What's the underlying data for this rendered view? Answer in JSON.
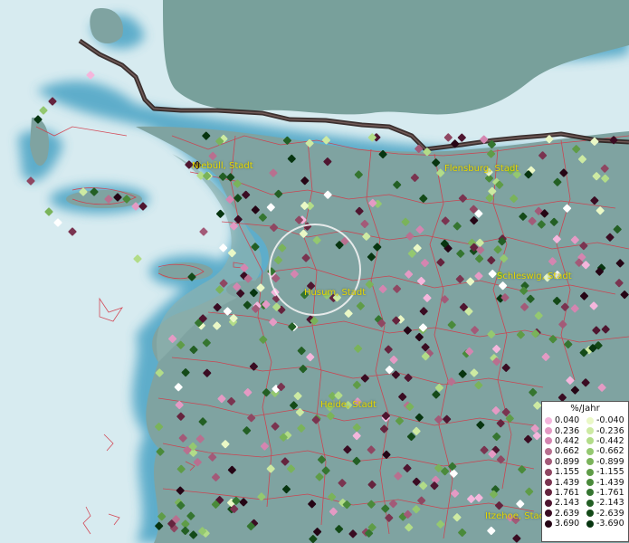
{
  "cities": [
    {
      "key": "niebuell",
      "label": "Niebüll, Stadt"
    },
    {
      "key": "flensburg",
      "label": "Flensburg, Stadt"
    },
    {
      "key": "schleswig",
      "label": "Schleswig, Stadt"
    },
    {
      "key": "husum",
      "label": "Husum, Stadt"
    },
    {
      "key": "heide",
      "label": "Heide, Stadt"
    },
    {
      "key": "itzehoe",
      "label": "Itzehoe, Stadt"
    }
  ],
  "legend": {
    "title": "%/Jahr",
    "positive": [
      {
        "value": "0.040",
        "color": "#f4b6dc"
      },
      {
        "value": "0.236",
        "color": "#e49ac4"
      },
      {
        "value": "0.442",
        "color": "#d485b0"
      },
      {
        "value": "0.662",
        "color": "#b8708f"
      },
      {
        "value": "0.899",
        "color": "#a35a78"
      },
      {
        "value": "1.155",
        "color": "#8f4762"
      },
      {
        "value": "1.439",
        "color": "#7a3450"
      },
      {
        "value": "1.761",
        "color": "#65243e"
      },
      {
        "value": "2.143",
        "color": "#4f1630"
      },
      {
        "value": "2.639",
        "color": "#3a0c22"
      },
      {
        "value": "3.690",
        "color": "#250515"
      }
    ],
    "negative": [
      {
        "value": "-0.040",
        "color": "#eaf8c6"
      },
      {
        "value": "-0.236",
        "color": "#cdeaa2"
      },
      {
        "value": "-0.442",
        "color": "#b2dc88"
      },
      {
        "value": "-0.662",
        "color": "#94c870"
      },
      {
        "value": "-0.899",
        "color": "#7ab35a"
      },
      {
        "value": "-1.155",
        "color": "#5f9c47"
      },
      {
        "value": "-1.439",
        "color": "#4a8a3a"
      },
      {
        "value": "-1.761",
        "color": "#357530"
      },
      {
        "value": "-2.143",
        "color": "#235f24"
      },
      {
        "value": "-2.639",
        "color": "#144a18"
      },
      {
        "value": "-3.690",
        "color": "#073510"
      }
    ]
  },
  "colors": {
    "sea": "#d7ebf0",
    "coast_water": "#3f9bbd",
    "land": "#7fa3a1",
    "denmark_land": "#78a09b",
    "border": "#2c1e1c",
    "district_lines": "#d23c4a",
    "city_label": "#e8d800",
    "highlight_circle": "#f2f2f2"
  }
}
